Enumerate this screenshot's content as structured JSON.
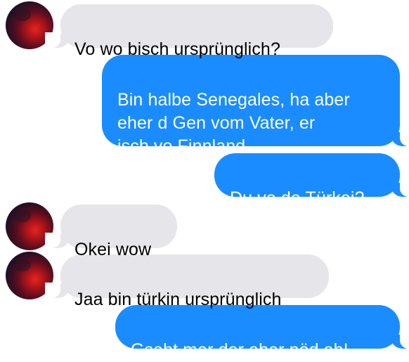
{
  "messages": [
    {
      "direction": "incoming",
      "text": "Vo wo bisch ursprünglich?",
      "avatar": "contact-avatar"
    },
    {
      "direction": "outgoing",
      "text": "Bin halbe Senegales, ha aber\neher d Gen vom Vater, er\nisch vo Finnland"
    },
    {
      "direction": "outgoing",
      "text": "Du vo de Türkei?"
    },
    {
      "direction": "incoming",
      "text": "Okei wow",
      "avatar": "contact-avatar"
    },
    {
      "direction": "incoming",
      "text": "Jaa bin türkin ursprünglich",
      "avatar": "contact-avatar"
    },
    {
      "direction": "outgoing",
      "text": "Gseht mer der aber nöd ah!"
    }
  ],
  "colors": {
    "incoming_bubble": "#e5e5ea",
    "outgoing_bubble": "#1a8cff",
    "incoming_text": "#000000",
    "outgoing_text": "#ffffff",
    "background": "#ffffff"
  }
}
